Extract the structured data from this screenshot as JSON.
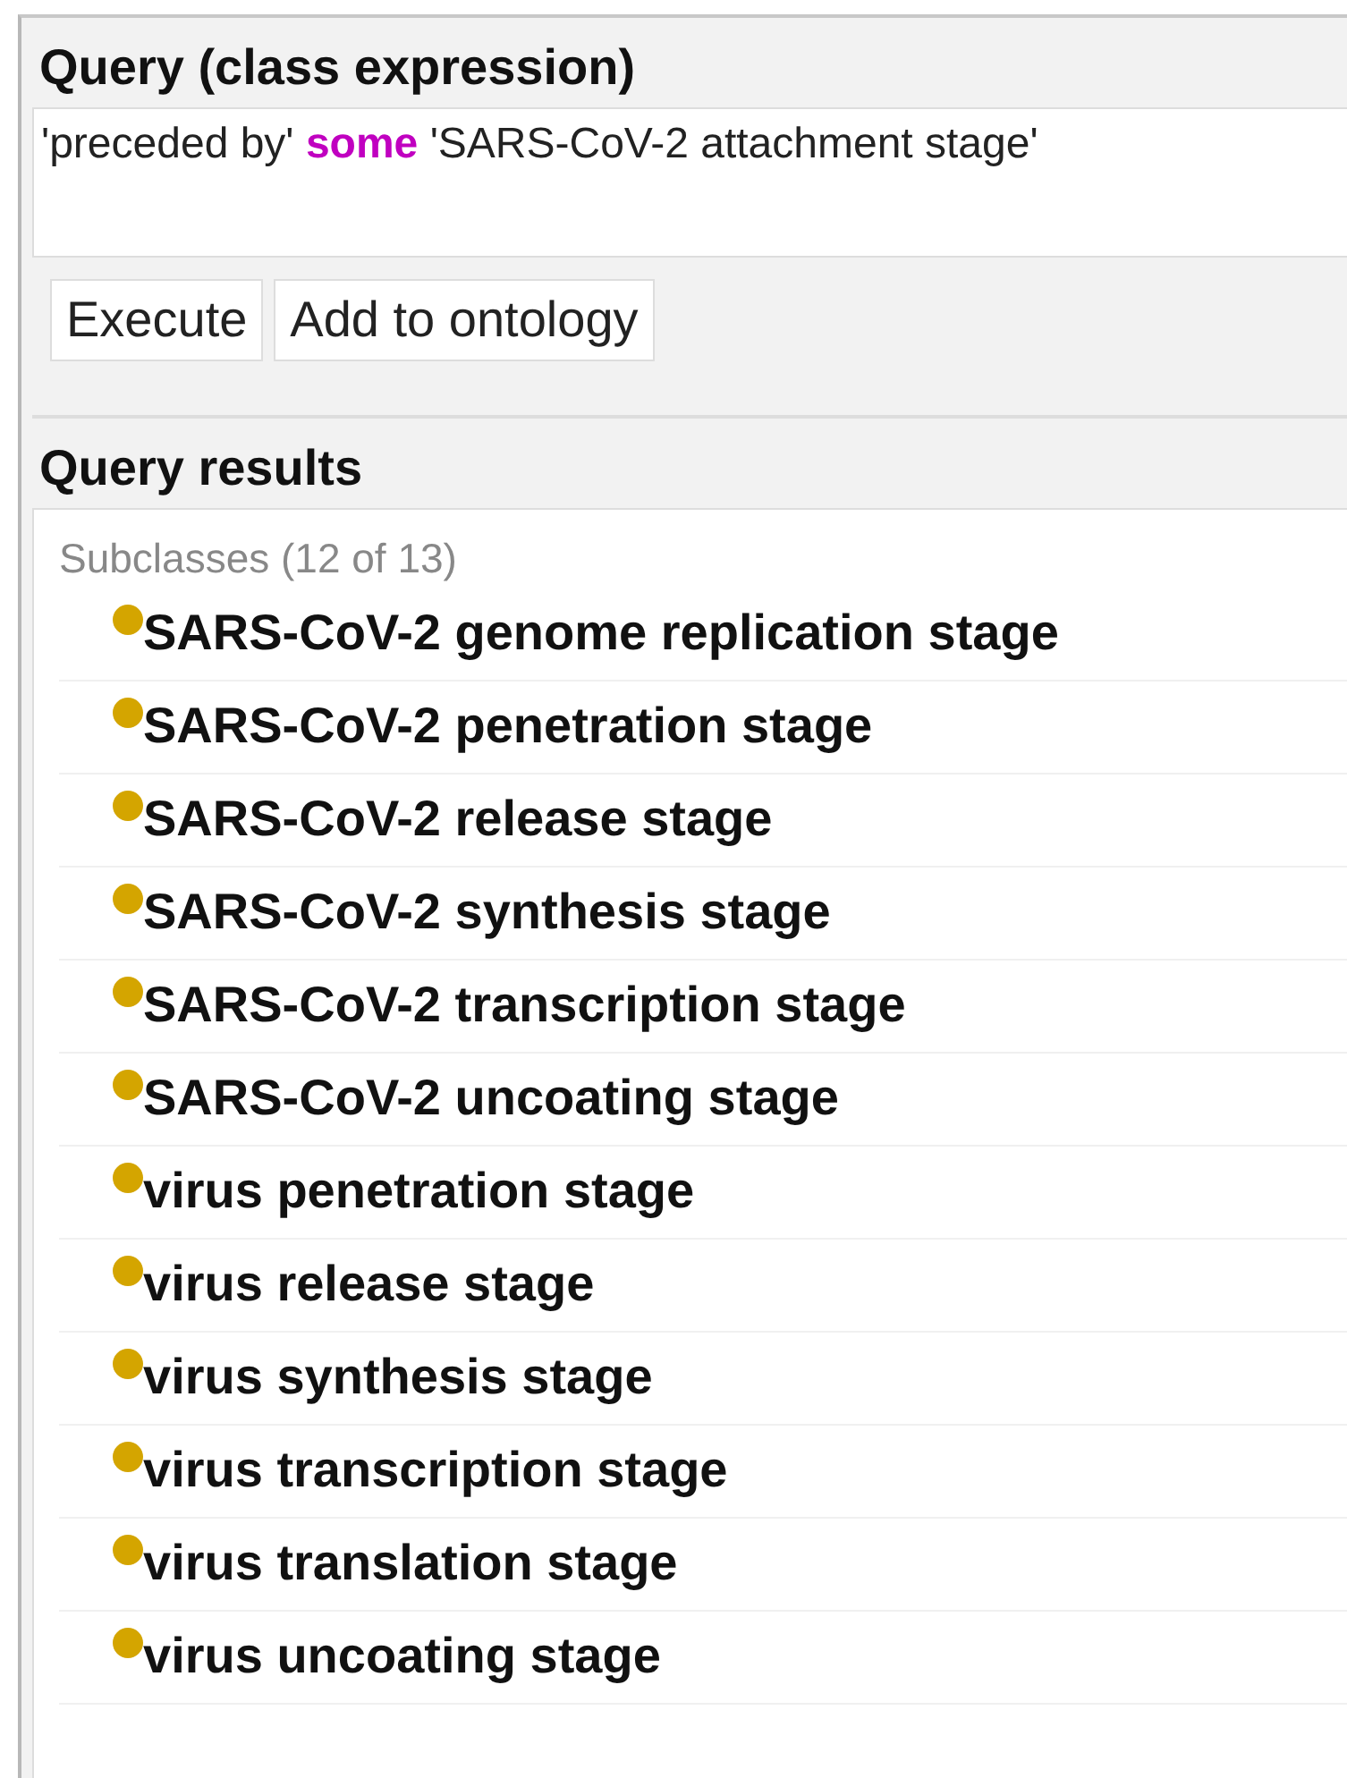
{
  "query_panel": {
    "title": "Query (class expression)",
    "expression": [
      {
        "kind": "text",
        "text": "'preceded by'"
      },
      {
        "kind": "keyword",
        "text": "some"
      },
      {
        "kind": "text",
        "text": "'SARS-CoV-2 attachment stage'"
      }
    ],
    "buttons": [
      "Execute",
      "Add to ontology"
    ]
  },
  "results_panel": {
    "title": "Query results",
    "group_label": "Subclasses (12 of 13)",
    "items": [
      {
        "label": "SARS-CoV-2 genome replication stage"
      },
      {
        "label": "SARS-CoV-2 penetration stage"
      },
      {
        "label": "SARS-CoV-2 release stage"
      },
      {
        "label": "SARS-CoV-2 synthesis stage"
      },
      {
        "label": "SARS-CoV-2 transcription stage"
      },
      {
        "label": "SARS-CoV-2 uncoating stage"
      },
      {
        "label": "virus penetration stage"
      },
      {
        "label": "virus release stage"
      },
      {
        "label": "virus synthesis stage"
      },
      {
        "label": "virus transcription stage"
      },
      {
        "label": "virus translation stage"
      },
      {
        "label": "virus uncoating stage"
      }
    ]
  }
}
